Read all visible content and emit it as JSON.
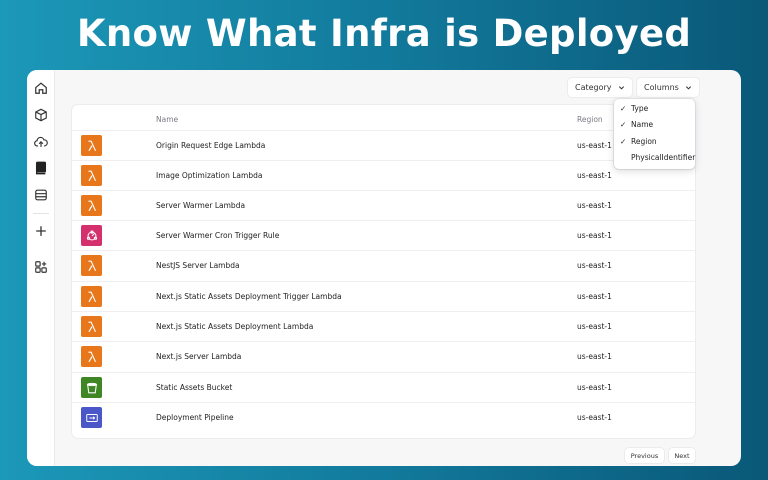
{
  "headline": "Know What Infra is Deployed",
  "sidebar": {
    "items": [
      {
        "name": "home-icon"
      },
      {
        "name": "cube-icon"
      },
      {
        "name": "cloud-upload-icon"
      },
      {
        "name": "book-icon"
      },
      {
        "name": "database-icon"
      },
      {
        "name": "plus-icon"
      },
      {
        "name": "grid-plus-icon"
      }
    ]
  },
  "toolbar": {
    "category_label": "Category",
    "columns_label": "Columns"
  },
  "table": {
    "headers": {
      "name": "Name",
      "region": "Region"
    },
    "rows": [
      {
        "icon": "lambda-icon",
        "name": "Origin Request Edge Lambda",
        "region": "us-east-1"
      },
      {
        "icon": "lambda-icon",
        "name": "Image Optimization Lambda",
        "region": "us-east-1"
      },
      {
        "icon": "lambda-icon",
        "name": "Server Warmer Lambda",
        "region": "us-east-1"
      },
      {
        "icon": "eventbridge-icon",
        "name": "Server Warmer Cron Trigger Rule",
        "region": "us-east-1"
      },
      {
        "icon": "lambda-icon",
        "name": "NestJS Server Lambda",
        "region": "us-east-1"
      },
      {
        "icon": "lambda-icon",
        "name": "Next.js Static Assets Deployment Trigger Lambda",
        "region": "us-east-1"
      },
      {
        "icon": "lambda-icon",
        "name": "Next.js Static Assets Deployment Lambda",
        "region": "us-east-1"
      },
      {
        "icon": "lambda-icon",
        "name": "Next.js Server Lambda",
        "region": "us-east-1"
      },
      {
        "icon": "s3-bucket-icon",
        "name": "Static Assets Bucket",
        "region": "us-east-1"
      },
      {
        "icon": "codepipeline-icon",
        "name": "Deployment Pipeline",
        "region": "us-east-1"
      }
    ]
  },
  "columns_menu": {
    "items": [
      {
        "label": "Type",
        "checked": true
      },
      {
        "label": "Name",
        "checked": true
      },
      {
        "label": "Region",
        "checked": true
      },
      {
        "label": "PhysicalIdentifier",
        "checked": false
      }
    ]
  },
  "pagination": {
    "previous_label": "Previous",
    "next_label": "Next"
  },
  "colors": {
    "lambda": "#e8761a",
    "eventbridge": "#d3306d",
    "s3": "#3f8624",
    "codepipeline": "#4a57c8",
    "bg_gradient_start": "#1c98b8",
    "bg_gradient_end": "#0a5878"
  }
}
